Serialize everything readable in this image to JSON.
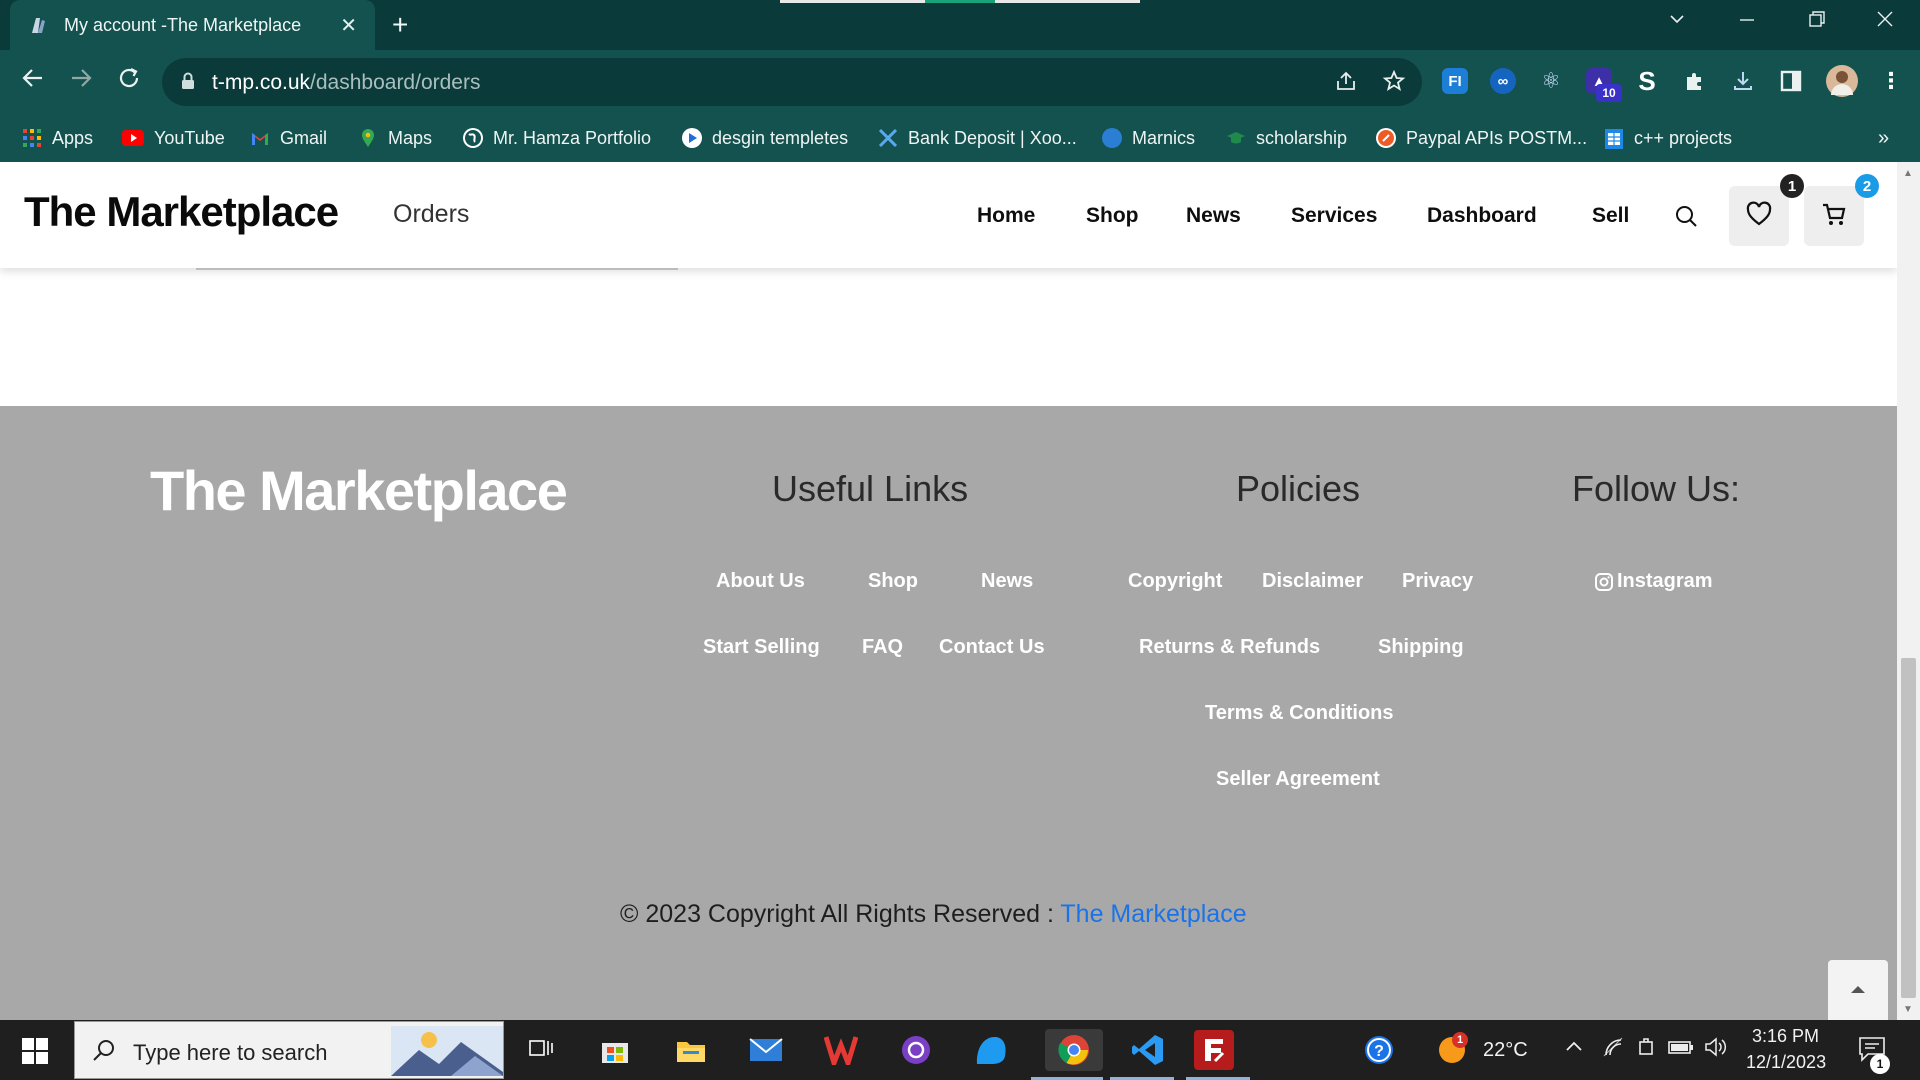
{
  "browser": {
    "tab_title": "My account -The Marketplace",
    "url_host": "t-mp.co.uk",
    "url_path": "/dashboard/orders",
    "bookmarks": [
      "Apps",
      "YouTube",
      "Gmail",
      "Maps",
      "Mr. Hamza Portfolio",
      "desgin templetes",
      "Bank Deposit | Xoo...",
      "Marnics",
      "scholarship",
      "Paypal APIs POSTM...",
      "c++ projects"
    ],
    "bookmarks_more": "»",
    "ext_badge": "10"
  },
  "header": {
    "brand": "The Marketplace",
    "page_name": "Orders",
    "nav": [
      "Home",
      "Shop",
      "News",
      "Services",
      "Dashboard",
      "Sell"
    ],
    "wishlist_count": "1",
    "cart_count": "2"
  },
  "footer": {
    "brand": "The Marketplace",
    "useful_links_heading": "Useful Links",
    "policies_heading": "Policies",
    "follow_heading": "Follow Us:",
    "useful_links": [
      "About Us",
      "Shop",
      "News",
      "Start Selling",
      "FAQ",
      "Contact Us"
    ],
    "policies": [
      "Copyright",
      "Disclaimer",
      "Privacy",
      "Returns & Refunds",
      "Shipping",
      "Terms & Conditions",
      "Seller Agreement"
    ],
    "social": [
      "Instagram"
    ],
    "copyright_text": "© 2023 Copyright All Rights Reserved : ",
    "copyright_link": "The Marketplace"
  },
  "taskbar": {
    "search_placeholder": "Type here to search",
    "weather": "22°C",
    "time": "3:16 PM",
    "date": "12/1/2023",
    "notification_count": "1",
    "weather_badge": "1"
  },
  "colors": {
    "chrome_dark": "#0b3a3a",
    "chrome_mid": "#14524f",
    "footer_bg": "#a8a8a8",
    "link_blue": "#1a73e8",
    "badge_blue": "#1a9be6"
  }
}
